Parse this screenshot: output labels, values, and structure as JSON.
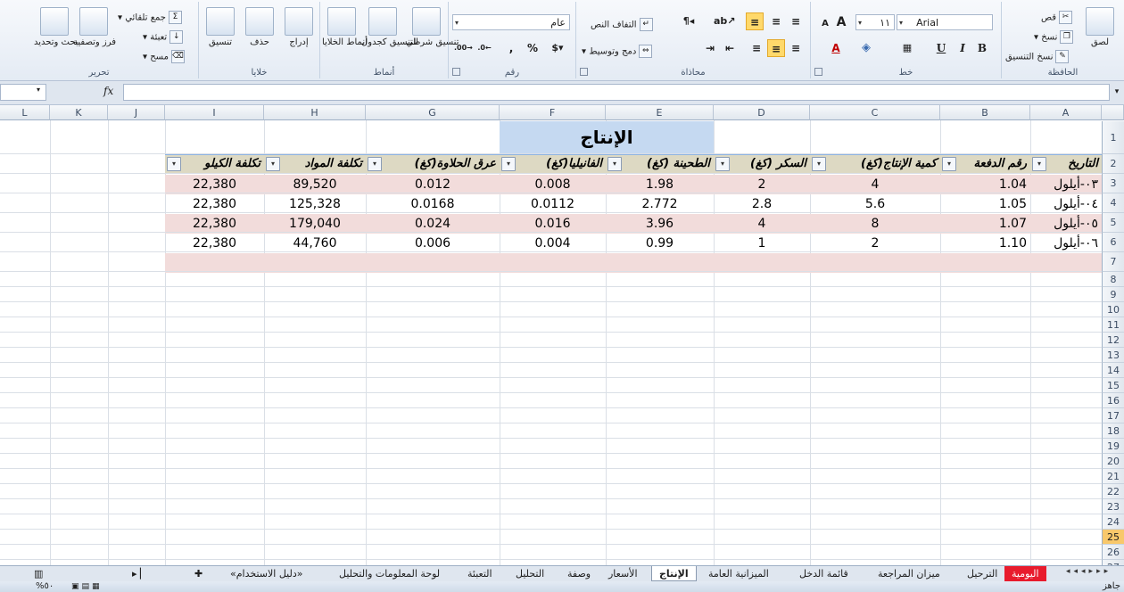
{
  "ribbon": {
    "clipboard": {
      "paste": "لصق",
      "cut": "قص",
      "copy": "نسخ",
      "format_painter": "نسخ التنسيق",
      "label": "الحافظة"
    },
    "font": {
      "name": "Arial",
      "size": "١١",
      "bold": "B",
      "italic": "I",
      "underline": "U",
      "grow": "A",
      "shrink": "A",
      "label": "خط"
    },
    "alignment": {
      "wrap_text": "التفاف النص",
      "merge_center": "دمج وتوسيط",
      "label": "محاذاة"
    },
    "number": {
      "format": "عام",
      "percent": "%",
      "comma": ",",
      "label": "رقم"
    },
    "styles": {
      "conditional": "تنسيق شرطي",
      "format_table": "التنسيق كجدول",
      "cell_styles": "أنماط الخلايا",
      "label": "أنماط"
    },
    "cells": {
      "insert": "إدراج",
      "delete": "حذف",
      "format": "تنسيق",
      "label": "خلايا"
    },
    "editing": {
      "autosum": "جمع تلقائي",
      "fill": "تعبئة",
      "clear": "مسح",
      "sort_filter": "فرز وتصفية",
      "find_select": "بحث وتحديد",
      "label": "تحرير"
    }
  },
  "formula_bar": {
    "fx": "fx",
    "value": ""
  },
  "columns": [
    "A",
    "B",
    "C",
    "D",
    "E",
    "F",
    "G",
    "H",
    "I",
    "J",
    "K",
    "L"
  ],
  "rows": [
    "1",
    "2",
    "3",
    "4",
    "5",
    "6",
    "7",
    "8",
    "9",
    "10",
    "11",
    "12",
    "13",
    "14",
    "15",
    "16",
    "17",
    "18",
    "19",
    "20",
    "21",
    "22",
    "23",
    "24",
    "25",
    "26",
    "27"
  ],
  "selected_row": "25",
  "sheet_title": "الإنتاج",
  "table": {
    "headers": [
      "التاريخ",
      "رقم الدفعة",
      "كمية الإنتاج(كغ)",
      "السكر (كغ)",
      "الطحينة (كغ)",
      "الفانيليا(كغ)",
      "عرق الحلاوة(كغ)",
      "تكلفة المواد",
      "تكلفة الكيلو"
    ],
    "rows": [
      [
        "٠٣-أيلول",
        "1.04",
        "4",
        "2",
        "1.98",
        "0.008",
        "0.012",
        "89,520",
        "22,380"
      ],
      [
        "٠٤-أيلول",
        "1.05",
        "5.6",
        "2.8",
        "2.772",
        "0.0112",
        "0.0168",
        "125,328",
        "22,380"
      ],
      [
        "٠٥-أيلول",
        "1.07",
        "8",
        "4",
        "3.96",
        "0.016",
        "0.024",
        "179,040",
        "22,380"
      ],
      [
        "٠٦-أيلول",
        "1.10",
        "2",
        "1",
        "0.99",
        "0.004",
        "0.006",
        "44,760",
        "22,380"
      ]
    ]
  },
  "sheet_tabs": [
    "اليومية",
    "الترحيل",
    "ميزان المراجعة",
    "قائمة الدخل",
    "الميزانية العامة",
    "الإنتاج",
    "الأسعار",
    "وصفة",
    "التحليل",
    "التعبئة",
    "لوحة المعلومات والتحليل",
    "«دليل الاستخدام»"
  ],
  "active_tab": "الإنتاج",
  "status": {
    "ready": "جاهز",
    "zoom": "%٥٠"
  },
  "colors": {
    "title_fill": "#c5d9f1",
    "header_fill": "#ddd9c3",
    "band_fill": "#f2dcdb",
    "active_row": "#f8c86b",
    "red_tab": "#e81b2c"
  }
}
